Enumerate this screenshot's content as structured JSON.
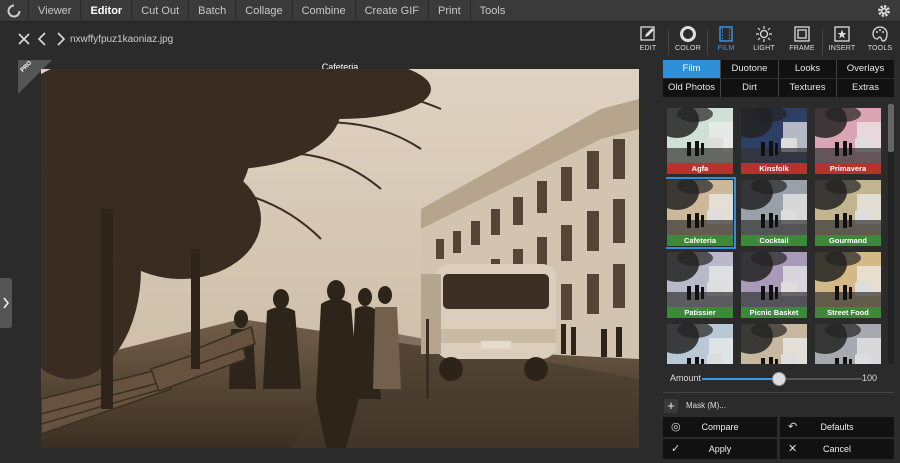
{
  "menubar": {
    "items": [
      "Viewer",
      "Editor",
      "Cut Out",
      "Batch",
      "Collage",
      "Combine",
      "Create GIF",
      "Print",
      "Tools"
    ],
    "active": "Editor",
    "logo_icon": "app-logo-icon",
    "settings_icon": "gear-icon"
  },
  "file": {
    "name": "nxwffyfpuz1kaoniaz.jpg"
  },
  "tools": [
    {
      "label": "EDIT",
      "icon": "pencil-icon"
    },
    {
      "label": "COLOR",
      "icon": "color-circle-icon"
    },
    {
      "label": "FILM",
      "icon": "film-icon",
      "active": true
    },
    {
      "label": "LIGHT",
      "icon": "sun-icon"
    },
    {
      "label": "FRAME",
      "icon": "frame-icon"
    },
    {
      "label": "INSERT",
      "icon": "star-insert-icon"
    },
    {
      "label": "TOOLS",
      "icon": "palette-icon"
    }
  ],
  "canvas": {
    "caption": "Cafeteria",
    "badge": "PRO"
  },
  "panel": {
    "tabs_row1": [
      "Film",
      "Duotone",
      "Looks",
      "Overlays"
    ],
    "tabs_row2": [
      "Old Photos",
      "Dirt",
      "Textures",
      "Extras"
    ],
    "active_tab": "Film",
    "thumbs": [
      {
        "name": "Agfa",
        "color": "#b8322d"
      },
      {
        "name": "Kinsfolk",
        "color": "#b8322d"
      },
      {
        "name": "Primavera",
        "color": "#b8322d"
      },
      {
        "name": "Cafeteria",
        "color": "#3b8a3a",
        "selected": true
      },
      {
        "name": "Cocktail",
        "color": "#3b8a3a"
      },
      {
        "name": "Gourmand",
        "color": "#3b8a3a"
      },
      {
        "name": "Patissier",
        "color": "#3b8a3a"
      },
      {
        "name": "Picnic Basket",
        "color": "#3b8a3a"
      },
      {
        "name": "Street Food",
        "color": "#3b8a3a"
      },
      {
        "name": "",
        "color": "#555"
      },
      {
        "name": "",
        "color": "#555"
      },
      {
        "name": "",
        "color": "#555"
      }
    ],
    "amount": {
      "label": "Amount",
      "value": "100",
      "fraction": 0.48
    },
    "mask": {
      "label": "Mask (M)..."
    },
    "buttons": {
      "compare": "Compare",
      "defaults": "Defaults",
      "apply": "Apply",
      "cancel": "Cancel"
    }
  }
}
